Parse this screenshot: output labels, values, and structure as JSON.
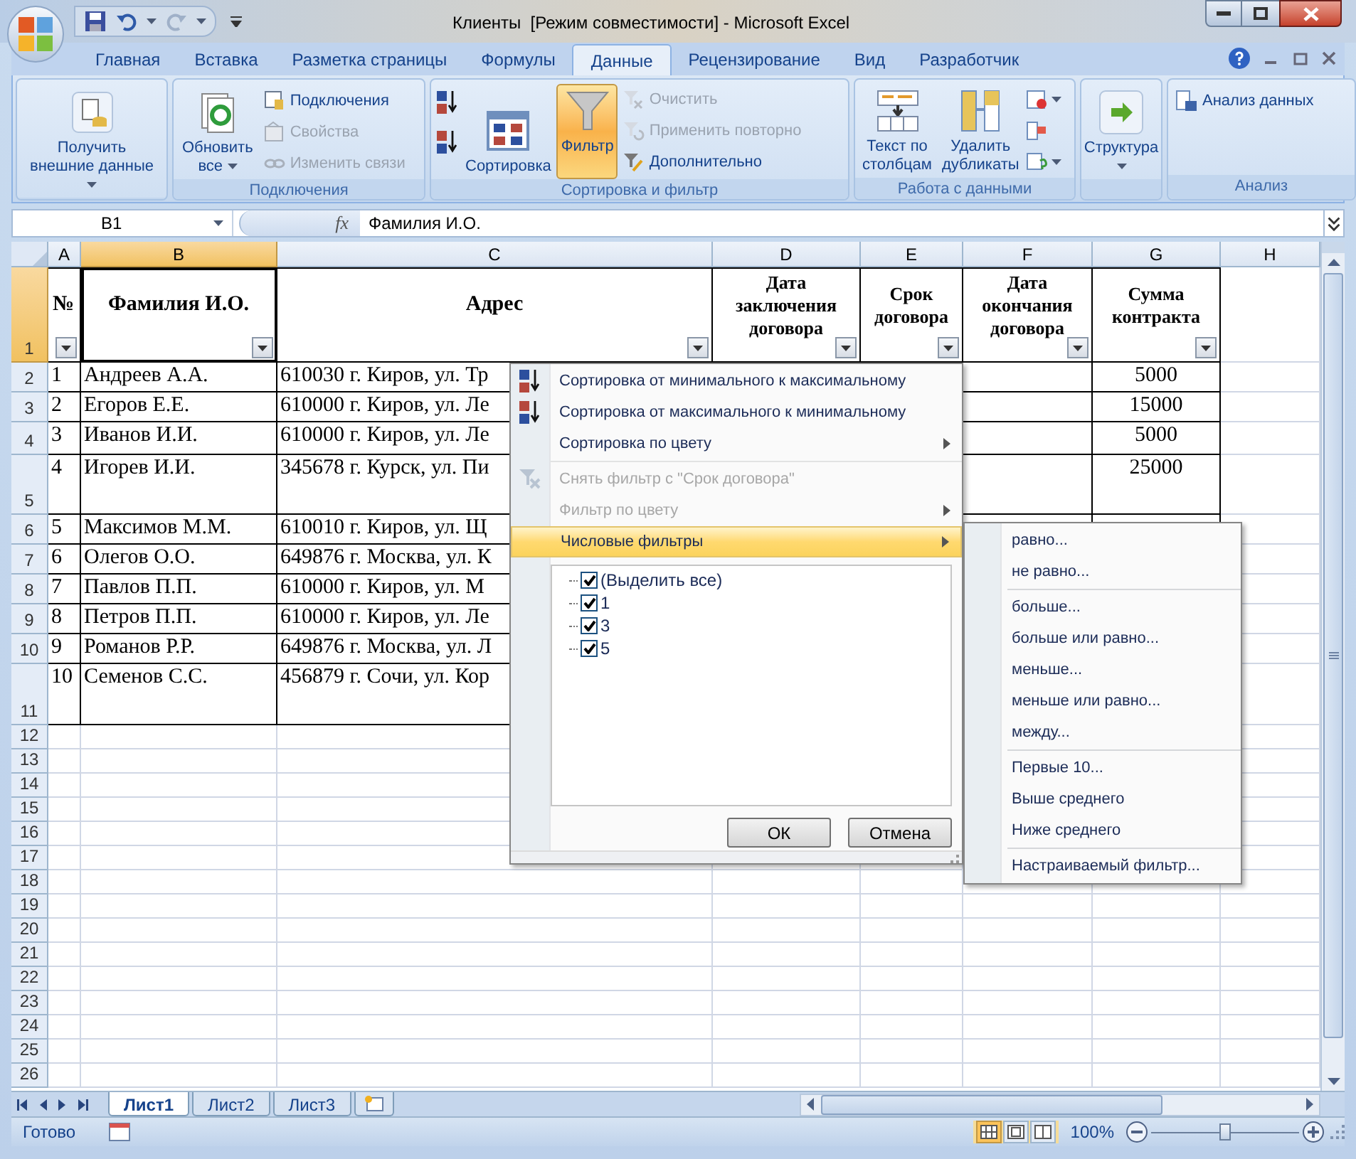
{
  "window": {
    "title": "Клиенты  [Режим совместимости] - Microsoft Excel"
  },
  "ribbon_tabs": [
    {
      "label": "Главная",
      "selected": false
    },
    {
      "label": "Вставка",
      "selected": false
    },
    {
      "label": "Разметка страницы",
      "selected": false
    },
    {
      "label": "Формулы",
      "selected": false
    },
    {
      "label": "Данные",
      "selected": true
    },
    {
      "label": "Рецензирование",
      "selected": false
    },
    {
      "label": "Вид",
      "selected": false
    },
    {
      "label": "Разработчик",
      "selected": false
    }
  ],
  "ribbon_groups": [
    {
      "buttons": [
        {
          "kind": "large",
          "label": "Получить\nвнешние данные",
          "dropdown": true,
          "disabled": false,
          "on": false
        }
      ]
    },
    {
      "label": "Подключения",
      "buttons": [
        {
          "kind": "large",
          "label": "Обновить\nвсе",
          "dropdown": true,
          "disabled": false,
          "on": false
        },
        {
          "kind": "small",
          "label": "Подключения",
          "disabled": false,
          "on": false
        },
        {
          "kind": "small",
          "label": "Свойства",
          "disabled": true,
          "on": false
        },
        {
          "kind": "small",
          "label": "Изменить связи",
          "disabled": true,
          "on": false
        }
      ]
    },
    {
      "label": "Сортировка и фильтр",
      "buttons": [
        {
          "kind": "icon",
          "disabled": false,
          "on": false
        },
        {
          "kind": "icon",
          "disabled": false,
          "on": false
        },
        {
          "kind": "large",
          "label": "Сортировка",
          "disabled": false,
          "on": false
        },
        {
          "kind": "large",
          "label": "Фильтр",
          "disabled": false,
          "on": true
        },
        {
          "kind": "small",
          "label": "Очистить",
          "disabled": true,
          "on": false
        },
        {
          "kind": "small",
          "label": "Применить повторно",
          "disabled": true,
          "on": false
        },
        {
          "kind": "small",
          "label": "Дополнительно",
          "disabled": false,
          "on": false
        }
      ]
    },
    {
      "label": "Работа с данными",
      "buttons": [
        {
          "kind": "large",
          "label": "Текст по\nстолбцам",
          "disabled": false,
          "on": false
        },
        {
          "kind": "large",
          "label": "Удалить\nдубликаты",
          "disabled": false,
          "on": false
        },
        {
          "kind": "icon",
          "dropdown": true,
          "disabled": false,
          "on": false
        },
        {
          "kind": "icon",
          "disabled": false,
          "on": false
        },
        {
          "kind": "icon",
          "dropdown": true,
          "disabled": false,
          "on": false
        }
      ]
    },
    {
      "buttons": [
        {
          "kind": "large",
          "label": "Структура",
          "dropdown": true,
          "disabled": false,
          "on": false
        }
      ]
    },
    {
      "label": "Анализ",
      "buttons": [
        {
          "kind": "small",
          "label": "Анализ данных",
          "disabled": false,
          "on": false
        }
      ]
    }
  ],
  "name_box": "B1",
  "formula_label": "fx",
  "formula": "Фамилия И.О.",
  "columns": [
    {
      "label": "A",
      "selected": false
    },
    {
      "label": "B",
      "selected": true
    },
    {
      "label": "C",
      "selected": false
    },
    {
      "label": "D",
      "selected": false
    },
    {
      "label": "E",
      "selected": false
    },
    {
      "label": "F",
      "selected": false
    },
    {
      "label": "G",
      "selected": false
    },
    {
      "label": "H",
      "selected": false
    }
  ],
  "rows": [
    {
      "header": "1",
      "selected": true,
      "headers": [
        "№",
        "Фамилия И.О.",
        "Адрес",
        "Дата заключения договора",
        "Срок договора",
        "Дата окончания договора",
        "Сумма контракта"
      ]
    },
    {
      "header": "2",
      "selected": false,
      "no": "1",
      "name": "Андреев А.А.",
      "address": "610030 г. Киров, ул. Тр",
      "amount": "5000"
    },
    {
      "header": "3",
      "selected": false,
      "no": "2",
      "name": "Егоров Е.Е.",
      "address": "610000 г. Киров, ул. Ле",
      "amount": "15000"
    },
    {
      "header": "4",
      "selected": false,
      "no": "3",
      "name": "Иванов И.И.",
      "address": "610000 г. Киров, ул. Ле",
      "amount": "5000"
    },
    {
      "header": "5",
      "selected": false,
      "no": "4",
      "name": "Игорев И.И.",
      "address": "345678 г. Курск, ул. Пи",
      "amount": "25000"
    },
    {
      "header": "6",
      "selected": false,
      "no": "5",
      "name": "Максимов М.М.",
      "address": "610010 г. Киров, ул. Щ"
    },
    {
      "header": "7",
      "selected": false,
      "no": "6",
      "name": "Олегов О.О.",
      "address": "649876 г. Москва, ул. К"
    },
    {
      "header": "8",
      "selected": false,
      "no": "7",
      "name": "Павлов П.П.",
      "address": "610000 г. Киров, ул. М"
    },
    {
      "header": "9",
      "selected": false,
      "no": "8",
      "name": "Петров П.П.",
      "address": "610000 г. Киров, ул. Ле"
    },
    {
      "header": "10",
      "selected": false,
      "no": "9",
      "name": "Романов Р.Р.",
      "address": "649876 г. Москва, ул. Л"
    },
    {
      "header": "11",
      "selected": false,
      "no": "10",
      "name": "Семенов С.С.",
      "address": "456879 г. Сочи, ул. Кор"
    },
    {
      "header": "12",
      "selected": false
    },
    {
      "header": "13",
      "selected": false
    },
    {
      "header": "14",
      "selected": false
    },
    {
      "header": "15",
      "selected": false
    },
    {
      "header": "16",
      "selected": false
    },
    {
      "header": "17",
      "selected": false
    },
    {
      "header": "18",
      "selected": false
    },
    {
      "header": "19",
      "selected": false
    },
    {
      "header": "20",
      "selected": false
    },
    {
      "header": "21",
      "selected": false
    },
    {
      "header": "22",
      "selected": false
    },
    {
      "header": "23",
      "selected": false
    },
    {
      "header": "24",
      "selected": false
    },
    {
      "header": "25",
      "selected": false
    },
    {
      "header": "26",
      "selected": false
    }
  ],
  "filter_menu": {
    "items": [
      {
        "kind": "item",
        "label": "Сортировка от минимального к максимальному",
        "disabled": false,
        "highlighted": false,
        "submenu": false
      },
      {
        "kind": "item",
        "label": "Сортировка от максимального к минимальному",
        "disabled": false,
        "highlighted": false,
        "submenu": false
      },
      {
        "kind": "item",
        "label": "Сортировка по цвету",
        "disabled": false,
        "highlighted": false,
        "submenu": true
      },
      {
        "kind": "separator"
      },
      {
        "kind": "item",
        "label": "Снять фильтр с \"Срок договора\"",
        "disabled": true,
        "highlighted": false,
        "submenu": false
      },
      {
        "kind": "item",
        "label": "Фильтр по цвету",
        "disabled": true,
        "highlighted": false,
        "submenu": true
      },
      {
        "kind": "item",
        "label": "Числовые фильтры",
        "disabled": false,
        "highlighted": true,
        "submenu": true
      }
    ],
    "values": [
      {
        "label": "(Выделить все)",
        "checked": true
      },
      {
        "label": "1",
        "checked": true
      },
      {
        "label": "3",
        "checked": true
      },
      {
        "label": "5",
        "checked": true
      }
    ],
    "buttons": [
      "ОК",
      "Отмена"
    ]
  },
  "submenu": {
    "items": [
      {
        "kind": "item",
        "label": "равно..."
      },
      {
        "kind": "item",
        "label": "не равно..."
      },
      {
        "kind": "separator"
      },
      {
        "kind": "item",
        "label": "больше..."
      },
      {
        "kind": "item",
        "label": "больше или равно..."
      },
      {
        "kind": "item",
        "label": "меньше..."
      },
      {
        "kind": "item",
        "label": "меньше или равно..."
      },
      {
        "kind": "item",
        "label": "между..."
      },
      {
        "kind": "separator"
      },
      {
        "kind": "item",
        "label": "Первые 10..."
      },
      {
        "kind": "item",
        "label": "Выше среднего"
      },
      {
        "kind": "item",
        "label": "Ниже среднего"
      },
      {
        "kind": "separator"
      },
      {
        "kind": "item",
        "label": "Настраиваемый фильтр..."
      }
    ]
  },
  "sheet_tabs": [
    {
      "label": "Лист1",
      "selected": true
    },
    {
      "label": "Лист2",
      "selected": false
    },
    {
      "label": "Лист3",
      "selected": false
    }
  ],
  "status": "Готово",
  "view_buttons": [
    {
      "selected": true
    },
    {
      "selected": false
    },
    {
      "selected": false
    }
  ],
  "zoom": {
    "reading": "100%",
    "level": 0.5
  }
}
